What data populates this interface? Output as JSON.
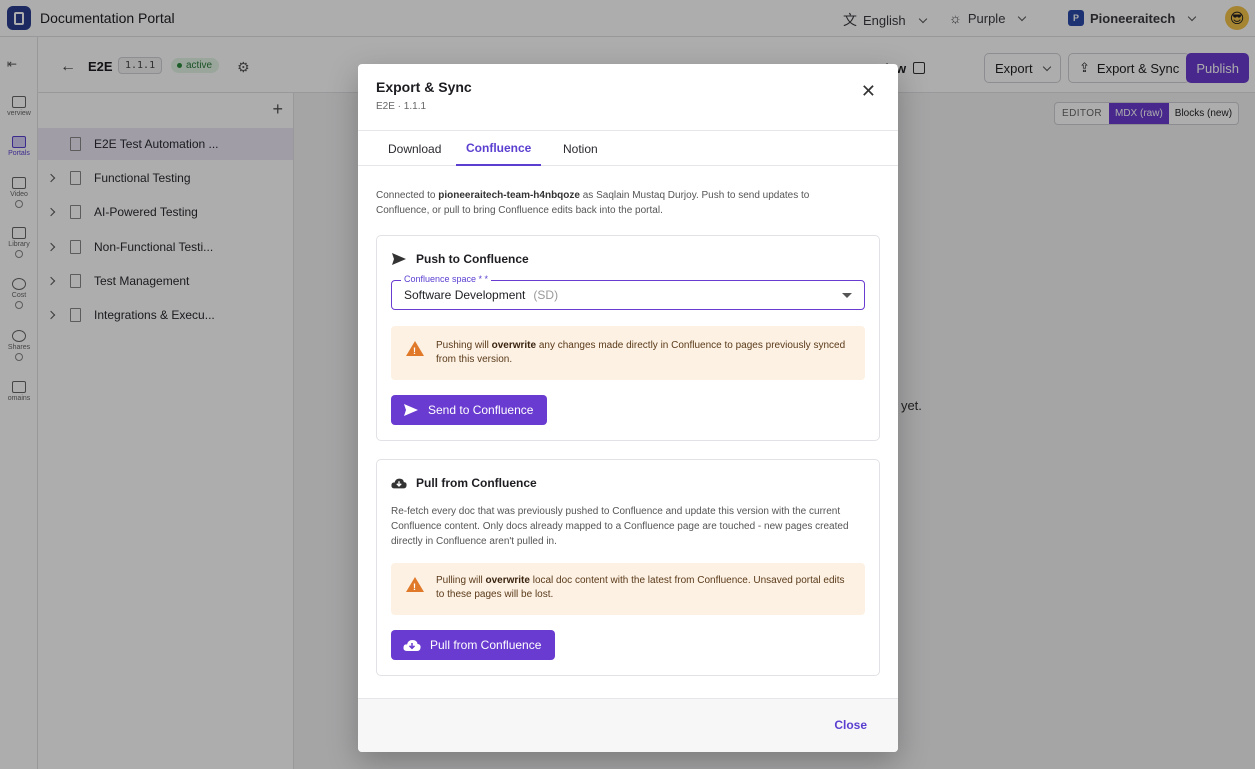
{
  "app": {
    "title": "Documentation Portal"
  },
  "topbar": {
    "language": "English",
    "theme": "Purple",
    "org_initial": "P",
    "org_name": "Pioneeraitech"
  },
  "rail": {
    "items": [
      {
        "label": "verview",
        "icon": "grid-icon"
      },
      {
        "label": "Portals",
        "icon": "portals-icon",
        "active": true
      },
      {
        "label": "Video",
        "icon": "video-icon"
      },
      {
        "label": "Library",
        "icon": "library-icon"
      },
      {
        "label": "Cost",
        "icon": "dollar-icon"
      },
      {
        "label": "Shares",
        "icon": "share-icon"
      },
      {
        "label": "omains",
        "icon": "domains-icon"
      }
    ]
  },
  "editor_header": {
    "title": "E2E",
    "version": "1.1.1",
    "status": "active",
    "preview_label": "Preview",
    "export_label": "Export",
    "export_sync_label": "Export & Sync",
    "publish_label": "Publish"
  },
  "tree": {
    "items": [
      {
        "label": "E2E Test Automation ...",
        "selected": true,
        "expandable": false
      },
      {
        "label": "Functional Testing",
        "expandable": true
      },
      {
        "label": "AI-Powered Testing",
        "expandable": true
      },
      {
        "label": "Non-Functional Testi...",
        "expandable": true
      },
      {
        "label": "Test Management",
        "expandable": true
      },
      {
        "label": "Integrations & Execu...",
        "expandable": true
      }
    ]
  },
  "canvas": {
    "empty_fragment": "uct yet.",
    "editor_label": "EDITOR",
    "mode_mdx": "MDX (raw)",
    "mode_blocks": "Blocks (new)"
  },
  "modal": {
    "title": "Export & Sync",
    "subtitle": "E2E · 1.1.1",
    "tabs": [
      "Download",
      "Confluence",
      "Notion"
    ],
    "active_tab": "Confluence",
    "intro_prefix": "Connected to ",
    "intro_account": "pioneeraitech-team-h4nbqoze",
    "intro_suffix": " as Saqlain Mustaq Durjoy. Push to send updates to Confluence, or pull to bring Confluence edits back into the portal.",
    "push": {
      "heading": "Push to Confluence",
      "field_label": "Confluence space * *",
      "space_name": "Software Development",
      "space_code": "(SD)",
      "warn_prefix": "Pushing will ",
      "warn_bold": "overwrite",
      "warn_suffix": " any changes made directly in Confluence to pages previously synced from this version.",
      "button": "Send to Confluence"
    },
    "pull": {
      "heading": "Pull from Confluence",
      "body": "Re-fetch every doc that was previously pushed to Confluence and update this version with the current Confluence content. Only docs already mapped to a Confluence page are touched - new pages created directly in Confluence aren't pulled in.",
      "warn_prefix": "Pulling will ",
      "warn_bold": "overwrite",
      "warn_suffix": " local doc content with the latest from Confluence. Unsaved portal edits to these pages will be lost.",
      "button": "Pull from Confluence"
    },
    "close_label": "Close"
  },
  "colors": {
    "accent": "#6a3bd0",
    "warning_bg": "#fdf1e3",
    "warning_icon": "#e07a2a",
    "active_status": "#2a7a39"
  }
}
